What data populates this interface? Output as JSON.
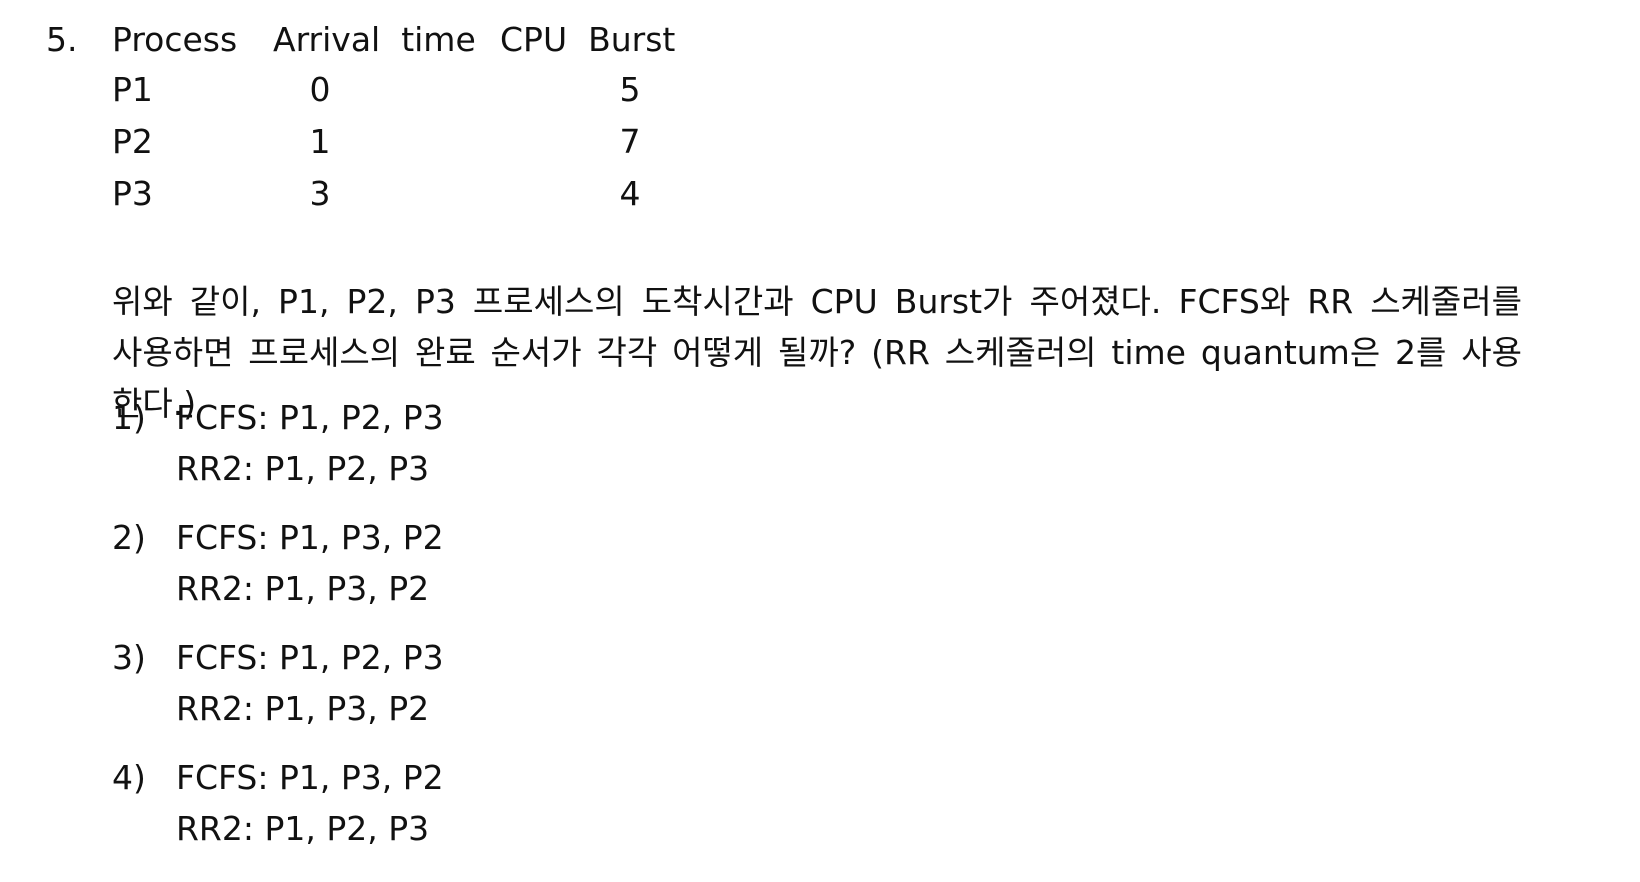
{
  "question": {
    "number": "5.",
    "headers": {
      "process": "Process",
      "arrival": "Arrival  time",
      "burst": "CPU  Burst"
    },
    "rows": [
      {
        "process": "P1",
        "arrival": "0",
        "burst": "5"
      },
      {
        "process": "P2",
        "arrival": "1",
        "burst": "7"
      },
      {
        "process": "P3",
        "arrival": "3",
        "burst": "4"
      }
    ],
    "description": "위와 같이, P1, P2, P3 프로세스의 도착시간과 CPU Burst가 주어졌다. FCFS와 RR 스케줄러를 사용하면 프로세스의 완료 순서가 각각 어떻게 될까? (RR 스케줄러의 time quantum은 2를 사용한다.)",
    "options": [
      {
        "num": "1)",
        "fcfs": "FCFS: P1, P2, P3",
        "rr": "RR2: P1, P2, P3"
      },
      {
        "num": "2)",
        "fcfs": "FCFS: P1, P3, P2",
        "rr": "RR2: P1, P3, P2"
      },
      {
        "num": "3)",
        "fcfs": "FCFS: P1, P2, P3",
        "rr": "RR2: P1, P3, P2"
      },
      {
        "num": "4)",
        "fcfs": "FCFS: P1, P3, P2",
        "rr": "RR2: P1, P2, P3"
      }
    ]
  }
}
